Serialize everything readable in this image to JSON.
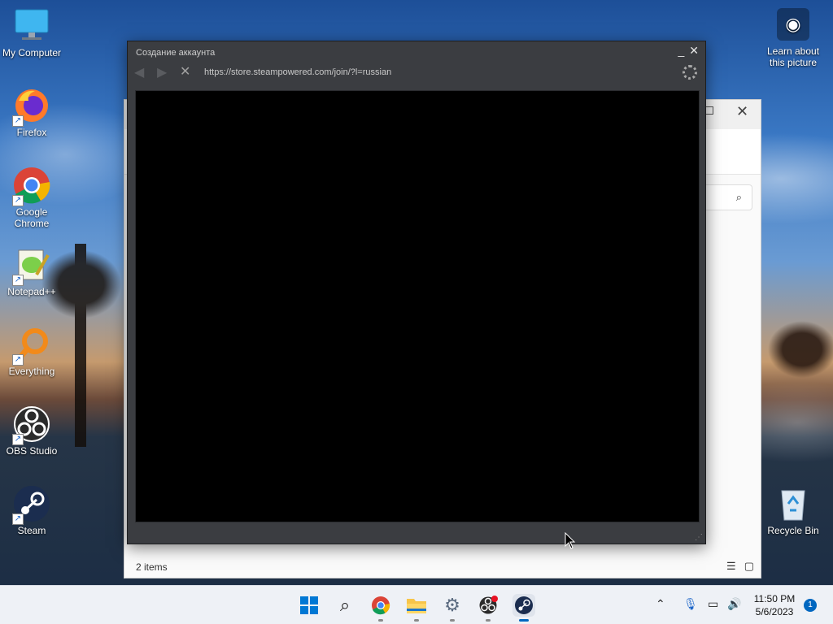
{
  "desktop_icons": [
    {
      "label": "My Computer"
    },
    {
      "label": "Firefox"
    },
    {
      "label": "Google Chrome"
    },
    {
      "label": "Notepad++"
    },
    {
      "label": "Everything"
    },
    {
      "label": "OBS Studio"
    },
    {
      "label": "Steam"
    }
  ],
  "recycle_bin": {
    "label": "Recycle Bin"
  },
  "learn_picture": {
    "label": "Learn about this picture"
  },
  "explorer": {
    "status": "2 items"
  },
  "steam_dialog": {
    "title": "Создание аккаунта",
    "url": "https://store.steampowered.com/join/?l=russian"
  },
  "taskbar": {
    "time": "11:50 PM",
    "date": "5/6/2023",
    "notification_count": "1"
  }
}
